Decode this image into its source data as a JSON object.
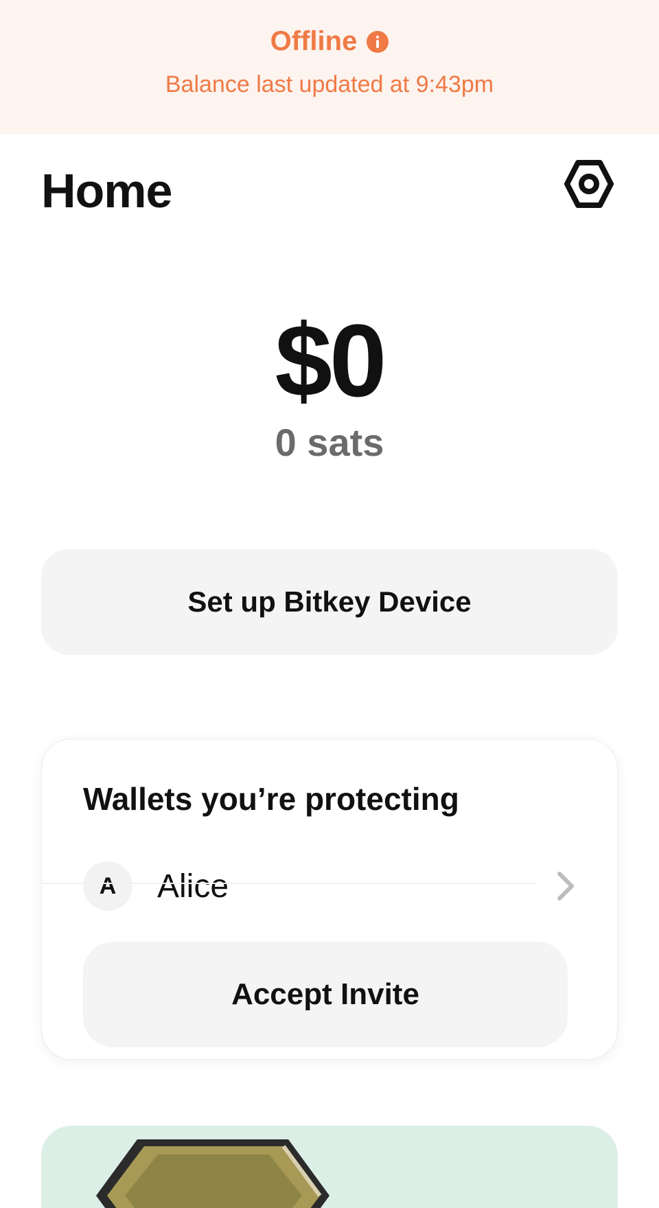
{
  "offline_banner": {
    "title": "Offline",
    "icon": "info-icon",
    "subtitle": "Balance last updated at 9:43pm",
    "accent_color": "#ef7a45",
    "background_color": "#fdf3ef"
  },
  "header": {
    "title": "Home",
    "settings_icon": "settings-icon"
  },
  "balance": {
    "fiat": "$0",
    "sats": "0 sats"
  },
  "setup_button": {
    "label": "Set up Bitkey Device"
  },
  "wallets_card": {
    "title": "Wallets you’re protecting",
    "items": [
      {
        "initial": "A",
        "name": "Alice",
        "icon": "chevron-right-icon"
      }
    ],
    "accept_button_label": "Accept Invite"
  },
  "promo_card": {
    "background_color": "#dcefe6",
    "image": "bitkey-device-illustration"
  }
}
